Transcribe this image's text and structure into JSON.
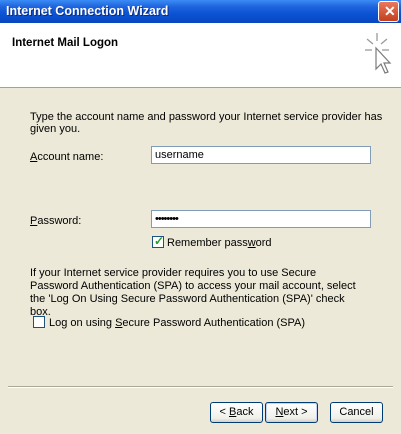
{
  "window": {
    "title": "Internet Connection Wizard"
  },
  "header": {
    "title": "Internet Mail Logon"
  },
  "intro_text": "Type the account name and password your Internet service provider has given you.",
  "account": {
    "label_first": "A",
    "label_rest": "ccount name:",
    "value": "username"
  },
  "password": {
    "label_first": "P",
    "label_rest": "assword:",
    "value": "••••••••"
  },
  "remember": {
    "label_pre": "Remember pass",
    "label_u": "w",
    "label_post": "ord",
    "checked": true
  },
  "spa_text": "If your Internet service provider requires you to use Secure Password Authentication (SPA) to access your mail account, select the 'Log On Using Secure Password Authentication (SPA)' check box.",
  "spa_checkbox": {
    "label_pre": "Log on using ",
    "label_u": "S",
    "label_post": "ecure Password Authentication (SPA)",
    "checked": false
  },
  "buttons": {
    "back_pre": "< ",
    "back_u": "B",
    "back_post": "ack",
    "next_u": "N",
    "next_post": "ext >",
    "cancel": "Cancel"
  },
  "colors": {
    "title_bar": "#0A53D4",
    "dialog_bg": "#ECE9D8",
    "check": "#21A121"
  }
}
